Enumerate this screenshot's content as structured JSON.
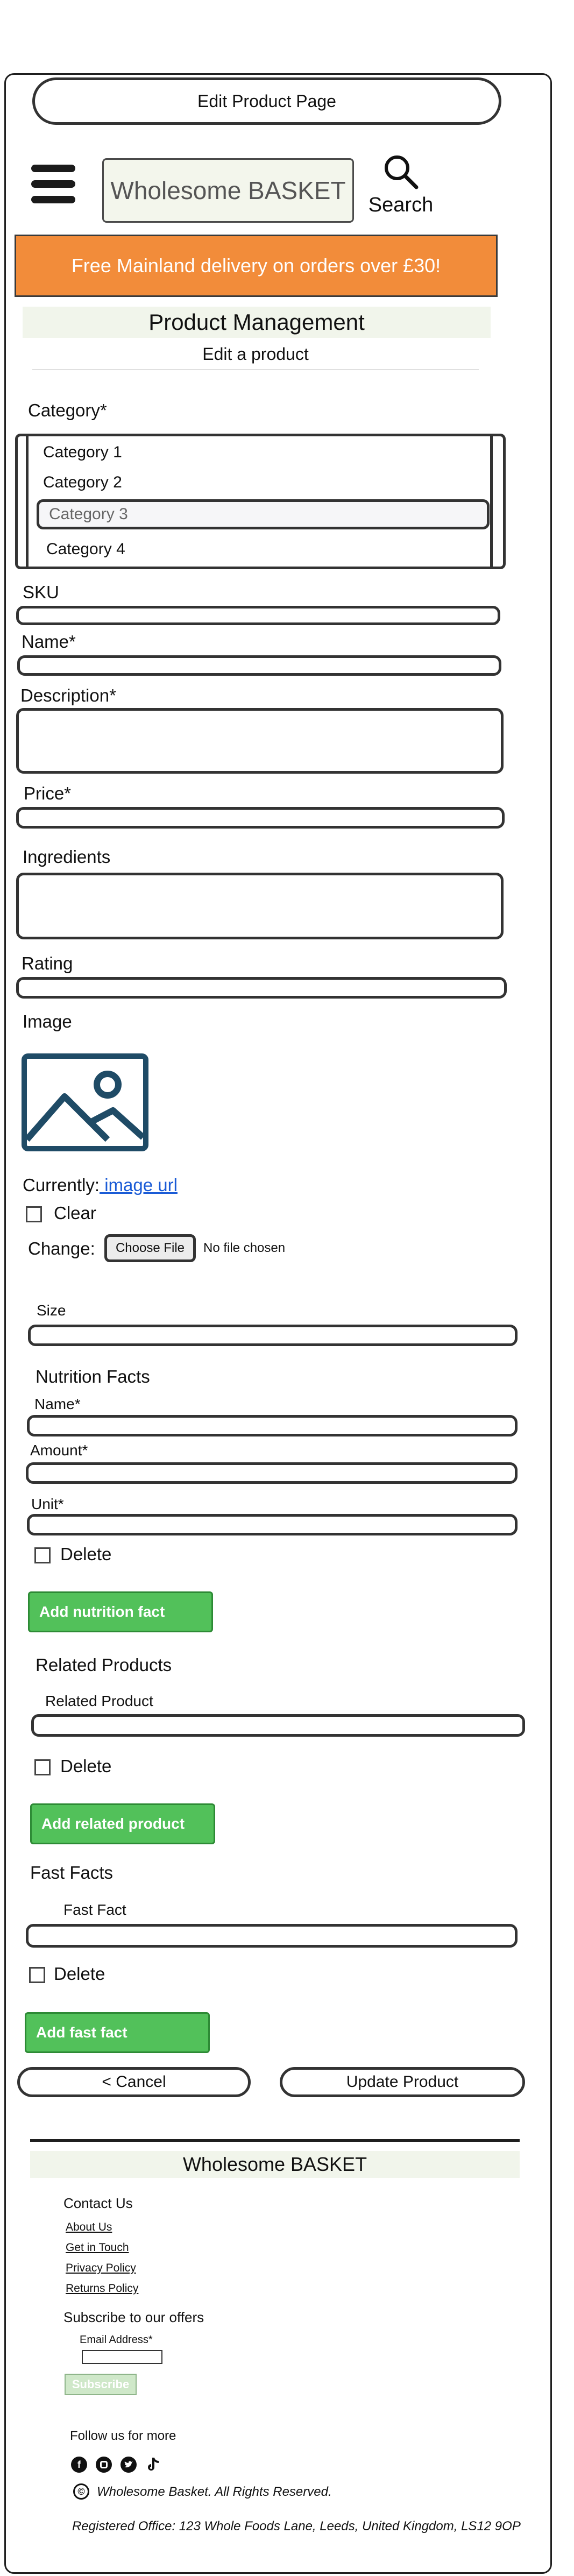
{
  "header": {
    "page_title": "Edit Product Page",
    "logo_text": "Wholesome BASKET",
    "search_label": "Search",
    "banner_text": "Free Mainland delivery on orders over £30!"
  },
  "main": {
    "section_title": "Product Management",
    "subtitle": "Edit a product"
  },
  "form": {
    "category_label": "Category*",
    "categories": [
      "Category 1",
      "Category 2",
      "Category 3",
      "Category 4"
    ],
    "selected_category": "Category 3",
    "sku_label": "SKU",
    "name_label": "Name*",
    "description_label": "Description*",
    "price_label": "Price*",
    "ingredients_label": "Ingredients",
    "rating_label": "Rating",
    "image_label": "Image",
    "currently_label": "Currently:",
    "image_link": " image url",
    "clear_label": "Clear",
    "change_label": "Change:",
    "choose_file": "Choose File",
    "no_file": "No file chosen",
    "size_label": "Size",
    "nutrition": {
      "heading": "Nutrition Facts",
      "name_label": "Name*",
      "amount_label": "Amount*",
      "unit_label": "Unit*",
      "delete_label": "Delete",
      "add_button": "Add nutrition fact"
    },
    "related": {
      "heading": "Related Products",
      "field_label": "Related Product",
      "delete_label": "Delete",
      "add_button": "Add related product"
    },
    "fast_facts": {
      "heading": "Fast Facts",
      "field_label": "Fast Fact",
      "delete_label": "Delete",
      "add_button": "Add fast fact"
    },
    "cancel_button": "< Cancel",
    "update_button": "Update Product"
  },
  "footer": {
    "brand": "Wholesome BASKET",
    "contact_heading": "Contact Us",
    "links": [
      "About Us",
      "Get in Touch",
      "Privacy Policy",
      "Returns Policy"
    ],
    "subscribe_heading": "Subscribe to our offers",
    "email_label": "Email Address*",
    "subscribe_button": "Subscribe",
    "follow_heading": "Follow us for more",
    "social_icons": [
      "facebook-icon",
      "instagram-icon",
      "twitter-icon",
      "tiktok-icon"
    ],
    "copyright_symbol": "©",
    "copyright": "Wholesome Basket. All Rights Reserved.",
    "registered_office": "Registered Office: 123 Whole Foods Lane, Leeds, United Kingdom, LS12 9OP"
  }
}
